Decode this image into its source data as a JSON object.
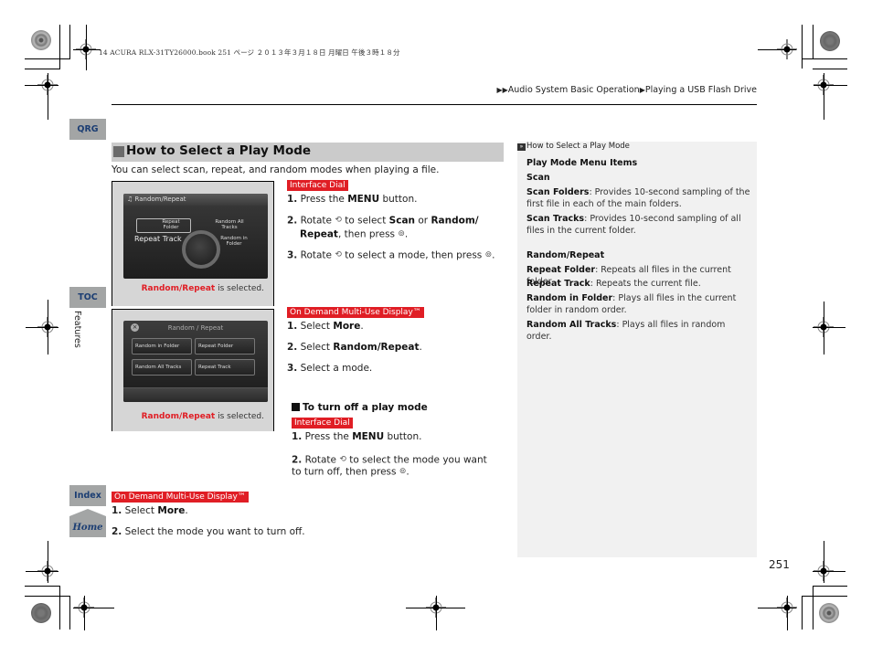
{
  "print_header": "14 ACURA RLX-31TY26000.book  251 ページ  ２０１３年３月１８日  月曜日  午後３時１８分",
  "breadcrumb": {
    "items": [
      "Audio System Basic Operation",
      "Playing a USB Flash Drive"
    ]
  },
  "side_tabs": {
    "qrg": "QRG",
    "toc": "TOC",
    "index": "Index",
    "home": "Home",
    "section_label": "Features"
  },
  "section": {
    "title": "How to Select a Play Mode",
    "intro": "You can select scan, repeat, and random modes when playing a file."
  },
  "figures": [
    {
      "screen_title": "Random/Repeat",
      "items": [
        "Repeat Folder",
        "Random All Tracks",
        "Repeat Track",
        "Random in Folder"
      ],
      "caption_bold": "Random/Repeat",
      "caption_rest": " is selected."
    },
    {
      "screen_title": "Random / Repeat",
      "items": [
        "Random in Folder",
        "Repeat Folder",
        "Random All Tracks",
        "Repeat Track"
      ],
      "caption_bold": "Random/Repeat",
      "caption_rest": " is selected."
    }
  ],
  "interface_dial": {
    "label": "Interface Dial",
    "steps": [
      {
        "n": "1.",
        "pre": " Press the ",
        "b": "MENU",
        "post": " button."
      },
      {
        "n": "2.",
        "pre": " Rotate ",
        "mid1": " to select ",
        "b1": "Scan",
        "mid2": " or ",
        "b2": "Random/",
        "line2_b": "Repeat",
        "line2_post": ", then press "
      },
      {
        "n": "3.",
        "pre": " Rotate ",
        "post": " to select a mode, then press "
      }
    ]
  },
  "odmd": {
    "label": "On Demand Multi-Use Display™",
    "steps": [
      {
        "n": "1.",
        "pre": " Select ",
        "b": "More",
        "post": "."
      },
      {
        "n": "2.",
        "pre": " Select ",
        "b": "Random/Repeat",
        "post": "."
      },
      {
        "n": "3.",
        "pre": " Select a mode.",
        "b": "",
        "post": ""
      }
    ]
  },
  "turn_off": {
    "title": "To turn off a play mode",
    "dial_label": "Interface Dial",
    "dial_steps": [
      {
        "n": "1.",
        "pre": " Press the ",
        "b": "MENU",
        "post": " button."
      },
      {
        "n": "2.",
        "pre": " Rotate ",
        "post": " to select the mode you want",
        "line2": "to turn off, then press "
      }
    ],
    "odmd_label": "On Demand Multi-Use Display™",
    "odmd_steps": [
      {
        "n": "1.",
        "pre": " Select ",
        "b": "More",
        "post": "."
      },
      {
        "n": "2.",
        "pre": " Select the mode you want to turn off.",
        "b": "",
        "post": ""
      }
    ]
  },
  "sidebar": {
    "ref": "How to Select a Play Mode",
    "heading": "Play Mode Menu Items",
    "scan_heading": "Scan",
    "scan_folders_b": "Scan Folders",
    "scan_folders_t": ": Provides 10-second sampling of the first file in each of the main folders.",
    "scan_tracks_b": "Scan Tracks",
    "scan_tracks_t": ": Provides 10-second sampling of all files in the current folder.",
    "rr_heading": "Random/Repeat",
    "repeat_folder_b": "Repeat Folder",
    "repeat_folder_t": ": Repeats all files in the current folder.",
    "repeat_track_b": "Repeat Track",
    "repeat_track_t": ": Repeats the current file.",
    "random_folder_b": "Random in Folder",
    "random_folder_t": ": Plays all files in the current folder in random order.",
    "random_all_b": "Random All Tracks",
    "random_all_t": ": Plays all files in random order."
  },
  "icons": {
    "rotate": "rotate-dial-icon",
    "press": "press-dial-icon"
  },
  "page_number": "251",
  "colors": {
    "accent_red": "#e01e25",
    "tab_gray": "#a3a5a5",
    "tab_text": "#1c3e73",
    "section_bar": "#cbcbcb",
    "sidebar_bg": "#f1f1f1"
  }
}
